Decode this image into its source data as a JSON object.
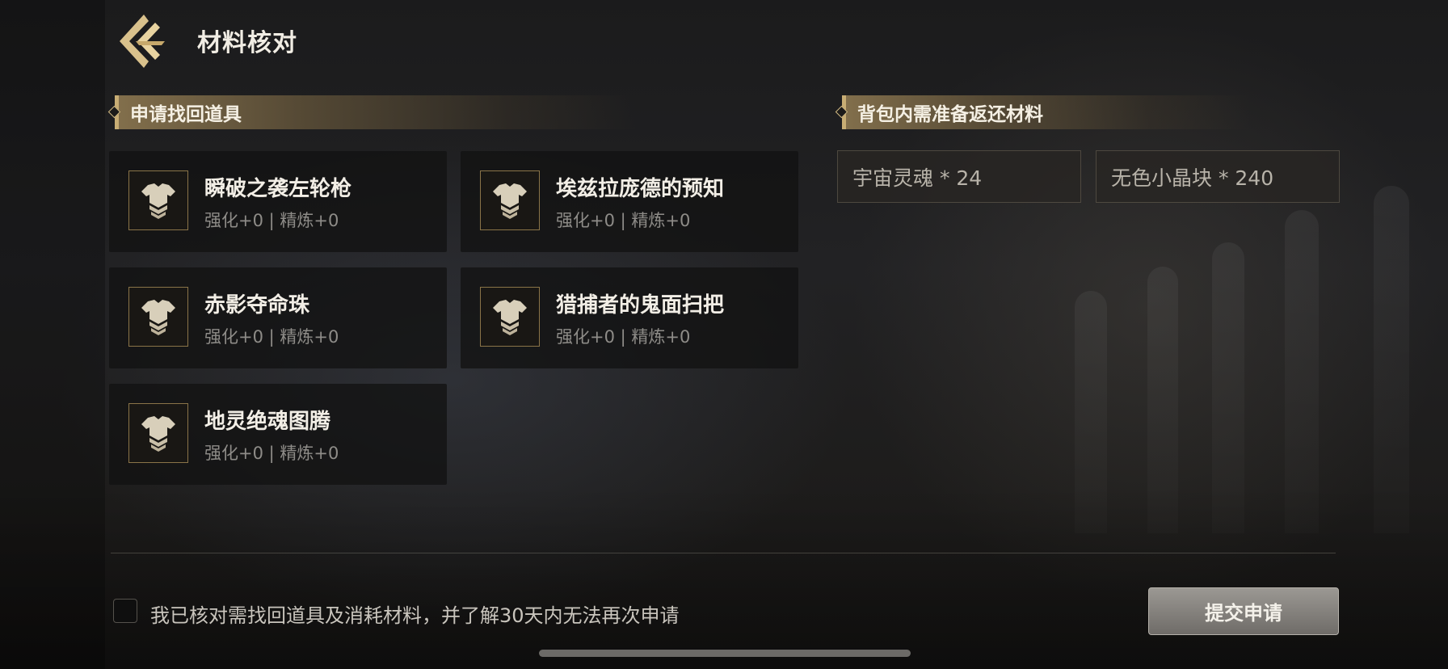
{
  "header": {
    "title": "材料核对",
    "back_icon": "back-arrow-icon"
  },
  "left_section": {
    "title": "申请找回道具",
    "items": [
      {
        "name": "瞬破之袭左轮枪",
        "sub": "强化+0 | 精炼+0",
        "icon": "armor-icon"
      },
      {
        "name": "埃兹拉庞德的预知",
        "sub": "强化+0 | 精炼+0",
        "icon": "armor-icon"
      },
      {
        "name": "赤影夺命珠",
        "sub": "强化+0 | 精炼+0",
        "icon": "armor-icon"
      },
      {
        "name": "猎捕者的鬼面扫把",
        "sub": "强化+0 | 精炼+0",
        "icon": "armor-icon"
      },
      {
        "name": "地灵绝魂图腾",
        "sub": "强化+0 | 精炼+0",
        "icon": "armor-icon"
      }
    ]
  },
  "right_section": {
    "title": "背包内需准备返还材料",
    "materials": [
      {
        "label": "宇宙灵魂 * 24"
      },
      {
        "label": "无色小晶块 * 240"
      }
    ]
  },
  "footer": {
    "confirm_text": "我已核对需找回道具及消耗材料，并了解30天内无法再次申请",
    "checkbox_checked": false,
    "submit_label": "提交申请"
  },
  "colors": {
    "accent_gold": "#c8ad74",
    "card_bg": "#121212",
    "text_primary": "#f2eee6",
    "text_secondary": "#8e8c88"
  }
}
